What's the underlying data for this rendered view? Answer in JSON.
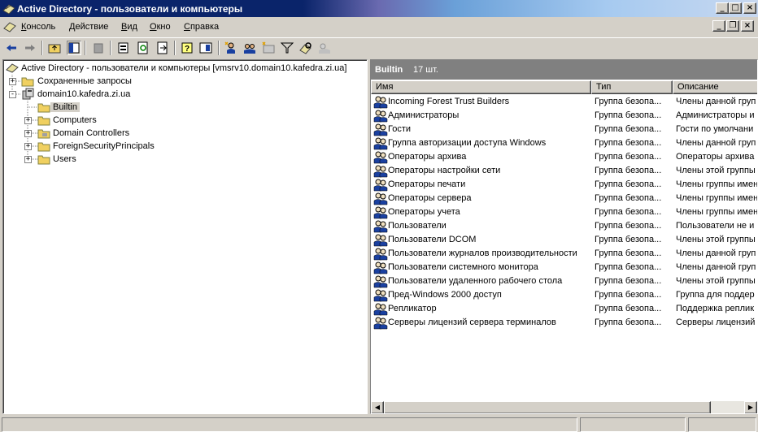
{
  "window": {
    "title": "Active Directory - пользователи и компьютеры",
    "minimize": "_",
    "maximize": "□",
    "close": "×"
  },
  "menu": {
    "items": [
      "Консоль",
      "Действие",
      "Вид",
      "Окно",
      "Справка"
    ]
  },
  "mdi": {
    "minimize": "_",
    "restore": "❐",
    "close": "×"
  },
  "toolbar": {
    "buttons": [
      "back-icon",
      "forward-icon",
      "up-folder-icon",
      "show-tree-icon",
      "delete-icon",
      "properties-icon",
      "refresh-icon",
      "export-list-icon",
      "help-icon",
      "show-console-tree-icon",
      "new-user-icon",
      "new-group-icon",
      "new-ou-icon",
      "filter-icon",
      "find-icon",
      "add-to-group-icon"
    ]
  },
  "tree": {
    "root": "Active Directory - пользователи и компьютеры [vmsrv10.domain10.kafedra.zi.ua]",
    "saved_queries": "Сохраненные запросы",
    "domain": "domain10.kafedra.zi.ua",
    "children": [
      "Builtin",
      "Computers",
      "Domain Controllers",
      "ForeignSecurityPrincipals",
      "Users"
    ],
    "selected": "Builtin"
  },
  "details": {
    "header_title": "Builtin",
    "header_count": "17 шт.",
    "columns": [
      "Имя",
      "Тип",
      "Описание"
    ],
    "rows": [
      {
        "name": "Incoming Forest Trust Builders",
        "type": "Группа безопа...",
        "desc": "Члены данной груп"
      },
      {
        "name": "Администраторы",
        "type": "Группа безопа...",
        "desc": "Администраторы и"
      },
      {
        "name": "Гости",
        "type": "Группа безопа...",
        "desc": "Гости по умолчани"
      },
      {
        "name": "Группа авторизации доступа Windows",
        "type": "Группа безопа...",
        "desc": "Члены данной груп"
      },
      {
        "name": "Операторы архива",
        "type": "Группа безопа...",
        "desc": "Операторы архива"
      },
      {
        "name": "Операторы настройки сети",
        "type": "Группа безопа...",
        "desc": "Члены этой группы"
      },
      {
        "name": "Операторы печати",
        "type": "Группа безопа...",
        "desc": "Члены группы имен"
      },
      {
        "name": "Операторы сервера",
        "type": "Группа безопа...",
        "desc": "Члены группы имен"
      },
      {
        "name": "Операторы учета",
        "type": "Группа безопа...",
        "desc": "Члены группы имен"
      },
      {
        "name": "Пользователи",
        "type": "Группа безопа...",
        "desc": "Пользователи не и"
      },
      {
        "name": "Пользователи DCOM",
        "type": "Группа безопа...",
        "desc": "Члены этой группы"
      },
      {
        "name": "Пользователи журналов производительности",
        "type": "Группа безопа...",
        "desc": "Члены данной груп"
      },
      {
        "name": "Пользователи системного монитора",
        "type": "Группа безопа...",
        "desc": "Члены данной груп"
      },
      {
        "name": "Пользователи удаленного рабочего стола",
        "type": "Группа безопа...",
        "desc": "Члены этой группы"
      },
      {
        "name": "Пред-Windows 2000 доступ",
        "type": "Группа безопа...",
        "desc": "Группа для поддер"
      },
      {
        "name": "Репликатор",
        "type": "Группа безопа...",
        "desc": "Поддержка реплик"
      },
      {
        "name": "Серверы лицензий сервера терминалов",
        "type": "Группа безопа...",
        "desc": "Серверы лицензий"
      }
    ]
  },
  "colors": {
    "title_active": "#0a246a",
    "face": "#d4d0c8",
    "header_gray": "#808080"
  }
}
